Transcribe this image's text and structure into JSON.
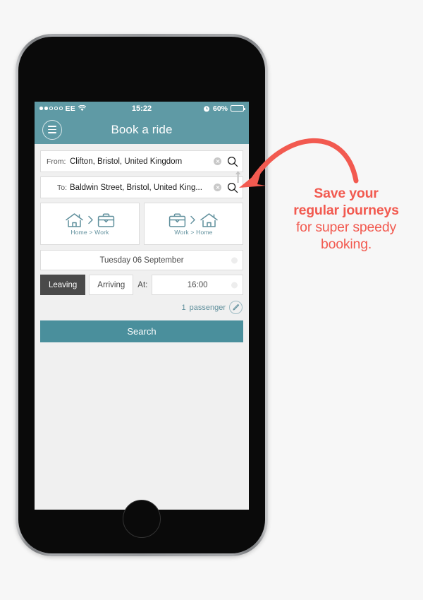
{
  "status_bar": {
    "signal_dots_filled": 2,
    "signal_dots_total": 5,
    "carrier": "EE",
    "wifi_icon": "wifi-icon",
    "time": "15:22",
    "alarm_icon": "alarm-clock-icon",
    "battery_percent": "60%",
    "battery_level": 60
  },
  "nav": {
    "menu_icon": "hamburger-menu-icon",
    "title": "Book a ride"
  },
  "form": {
    "from": {
      "label": "From:",
      "value": "Clifton, Bristol, United Kingdom",
      "clear_icon": "clear-circle-icon",
      "search_icon": "magnifier-icon"
    },
    "to": {
      "label": "To:",
      "value": "Baldwin Street, Bristol, United King...",
      "clear_icon": "clear-circle-icon",
      "search_icon": "magnifier-icon"
    },
    "swap_icon": "swap-up-down-arrows-icon"
  },
  "shortcuts": [
    {
      "label": "Home > Work",
      "from_icon": "house-icon",
      "to_icon": "briefcase-icon",
      "separator_icon": "chevron-right-icon"
    },
    {
      "label": "Work > Home",
      "from_icon": "briefcase-icon",
      "to_icon": "house-icon",
      "separator_icon": "chevron-right-icon"
    }
  ],
  "date": {
    "value": "Tuesday 06 September"
  },
  "time_row": {
    "leaving_label": "Leaving",
    "arriving_label": "Arriving",
    "selected": "Leaving",
    "at_label": "At:",
    "time_value": "16:00"
  },
  "passengers": {
    "count": "1",
    "label": "passenger",
    "edit_icon": "pencil-edit-icon"
  },
  "search_button": {
    "label": "Search"
  },
  "annotation": {
    "line1": "Save your",
    "line2": "regular journeys",
    "line3": "for super speedy",
    "line4": "booking.",
    "arrow_icon": "curved-arrow-icon"
  },
  "colors": {
    "teal": "#5f9aa5",
    "teal_button": "#4a8f9c",
    "coral": "#f25a50",
    "screen_bg": "#f0f0f0",
    "page_bg": "#f7f7f7",
    "segment_active": "#4a4a4a"
  },
  "device": {
    "earpiece": "earpiece-speaker",
    "camera": "front-camera",
    "home_button": "home-button"
  }
}
